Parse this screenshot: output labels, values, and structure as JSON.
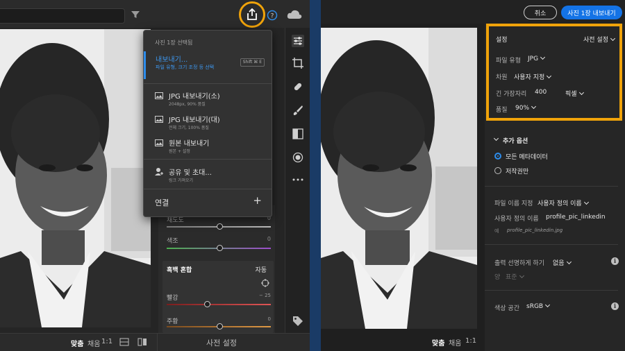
{
  "left_panel": {
    "bottom_bar": {
      "fit": "맞춤",
      "fill": "채움",
      "ratio": "1:1",
      "preset": "사전 설정"
    },
    "adjust": {
      "saturation_label": "채도도",
      "saturation_value": "0",
      "hue_label": "색조",
      "hue_value": "0",
      "bw_mix_label": "흑백 혼합",
      "auto_label": "자동",
      "red_label": "빨강",
      "red_value": "− 25",
      "orange_label": "주황",
      "orange_value": "0"
    }
  },
  "export_menu": {
    "header": "사진 1장 선택됨",
    "active": {
      "title": "내보내기...",
      "subtitle": "파일 유형, 크기 조정 등 선택",
      "shortcut": "Shift ⌘ E"
    },
    "items": [
      {
        "title": "JPG 내보내기(소)",
        "subtitle": "2048px, 90% 품질",
        "icon": "image-icon"
      },
      {
        "title": "JPG 내보내기(대)",
        "subtitle": "전체 크기, 100% 품질",
        "icon": "image-icon"
      },
      {
        "title": "원본 내보내기",
        "subtitle": "원본 + 설정",
        "icon": "image-icon"
      },
      {
        "title": "공유 및 초대...",
        "subtitle": "링크 가져오기",
        "icon": "add-user-icon"
      }
    ],
    "connect_label": "연결",
    "plus_label": "+"
  },
  "right_panel": {
    "cancel_label": "취소",
    "export_label": "사진 1장 내보내기",
    "bottom_bar": {
      "fit": "맞춤",
      "fill": "채움",
      "ratio": "1:1"
    },
    "settings": {
      "header": "설정",
      "preset_label": "사전 설정",
      "file_type_label": "파일 유형",
      "file_type_value": "JPG",
      "dimension_label": "차원",
      "dimension_value": "사용자 지정",
      "long_edge_label": "긴 가장자리",
      "long_edge_value": "400",
      "unit_value": "픽셀",
      "quality_label": "품질",
      "quality_value": "90%"
    },
    "more_options": {
      "header": "추가 옵션",
      "option_all_metadata": "모든 메타데이터",
      "option_copyright": "저작권만"
    },
    "file_naming": {
      "label": "파일 이름 지정",
      "value": "사용자 정의 이름",
      "custom_name_label": "사용자 정의 이름",
      "custom_name_value": "profile_pic_linkedin",
      "example_prefix": "예",
      "example_value": "profile_pic_linkedin.jpg"
    },
    "sharpen": {
      "label": "출력 선명하게 하기",
      "value": "없음",
      "amount_label": "양",
      "amount_value": "표준"
    },
    "color_space": {
      "label": "색상 공간",
      "value": "sRGB"
    }
  },
  "colors": {
    "accent_orange": "#f0a30a",
    "accent_blue": "#1473e6",
    "divider_blue": "#1a3b66"
  }
}
